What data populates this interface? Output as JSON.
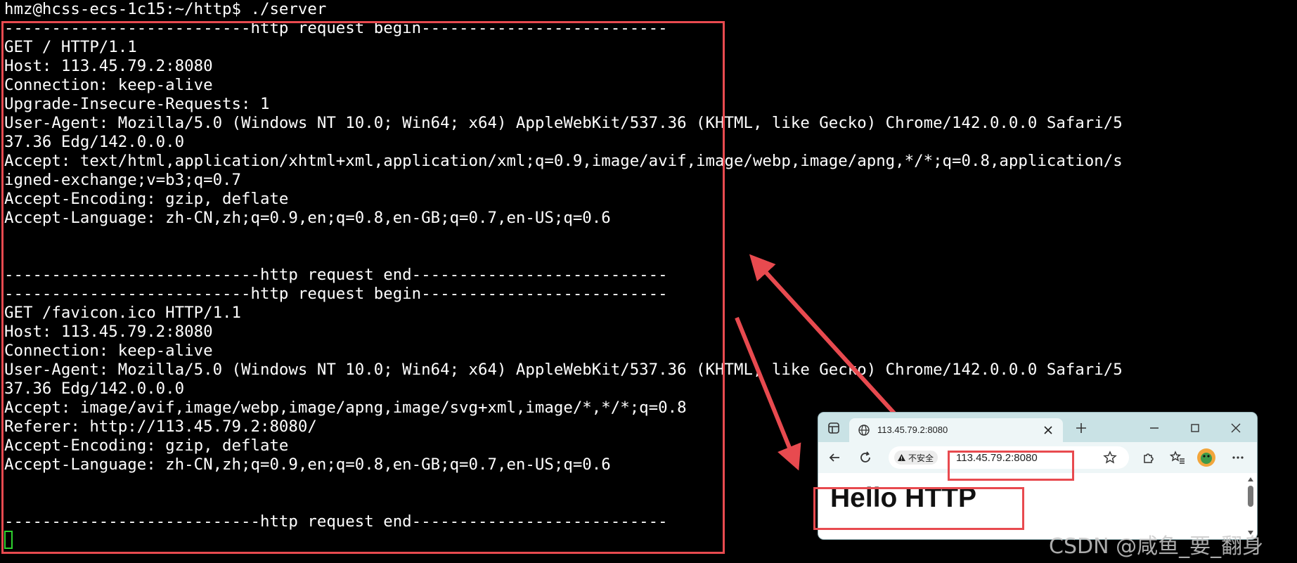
{
  "terminal": {
    "lines": [
      "hmz@hcss-ecs-1c15:~/http$ ./server",
      "--------------------------http request begin--------------------------",
      "GET / HTTP/1.1",
      "Host: 113.45.79.2:8080",
      "Connection: keep-alive",
      "Upgrade-Insecure-Requests: 1",
      "User-Agent: Mozilla/5.0 (Windows NT 10.0; Win64; x64) AppleWebKit/537.36 (KHTML, like Gecko) Chrome/142.0.0.0 Safari/5",
      "37.36 Edg/142.0.0.0",
      "Accept: text/html,application/xhtml+xml,application/xml;q=0.9,image/avif,image/webp,image/apng,*/*;q=0.8,application/s",
      "igned-exchange;v=b3;q=0.7",
      "Accept-Encoding: gzip, deflate",
      "Accept-Language: zh-CN,zh;q=0.9,en;q=0.8,en-GB;q=0.7,en-US;q=0.6",
      "",
      "",
      "---------------------------http request end---------------------------",
      "--------------------------http request begin--------------------------",
      "GET /favicon.ico HTTP/1.1",
      "Host: 113.45.79.2:8080",
      "Connection: keep-alive",
      "User-Agent: Mozilla/5.0 (Windows NT 10.0; Win64; x64) AppleWebKit/537.36 (KHTML, like Gecko) Chrome/142.0.0.0 Safari/5",
      "37.36 Edg/142.0.0.0",
      "Accept: image/avif,image/webp,image/apng,image/svg+xml,image/*,*/*;q=0.8",
      "Referer: http://113.45.79.2:8080/",
      "Accept-Encoding: gzip, deflate",
      "Accept-Language: zh-CN,zh;q=0.9,en;q=0.8,en-GB;q=0.7,en-US;q=0.6",
      "",
      "",
      "---------------------------http request end---------------------------"
    ]
  },
  "browser": {
    "tab_title": "113.45.79.2:8080",
    "security_label": "不安全",
    "url": "113.45.79.2:8080",
    "page_heading": "Hello HTTP"
  },
  "watermark": "CSDN @咸鱼_要_翻身",
  "colors": {
    "terminal_bg": "#000000",
    "terminal_text": "#ffffff",
    "annotation_red": "#e84a4f",
    "cursor_green": "#2fd02f",
    "browser_frame": "#c9e2e5"
  },
  "icons": [
    "sidebar-icon",
    "globe-icon",
    "close-icon",
    "plus-icon",
    "minimize-icon",
    "maximize-icon",
    "back-arrow-icon",
    "refresh-icon",
    "warning-icon",
    "star-icon",
    "extensions-icon",
    "favorites-icon",
    "avatar-icon",
    "more-icon"
  ]
}
